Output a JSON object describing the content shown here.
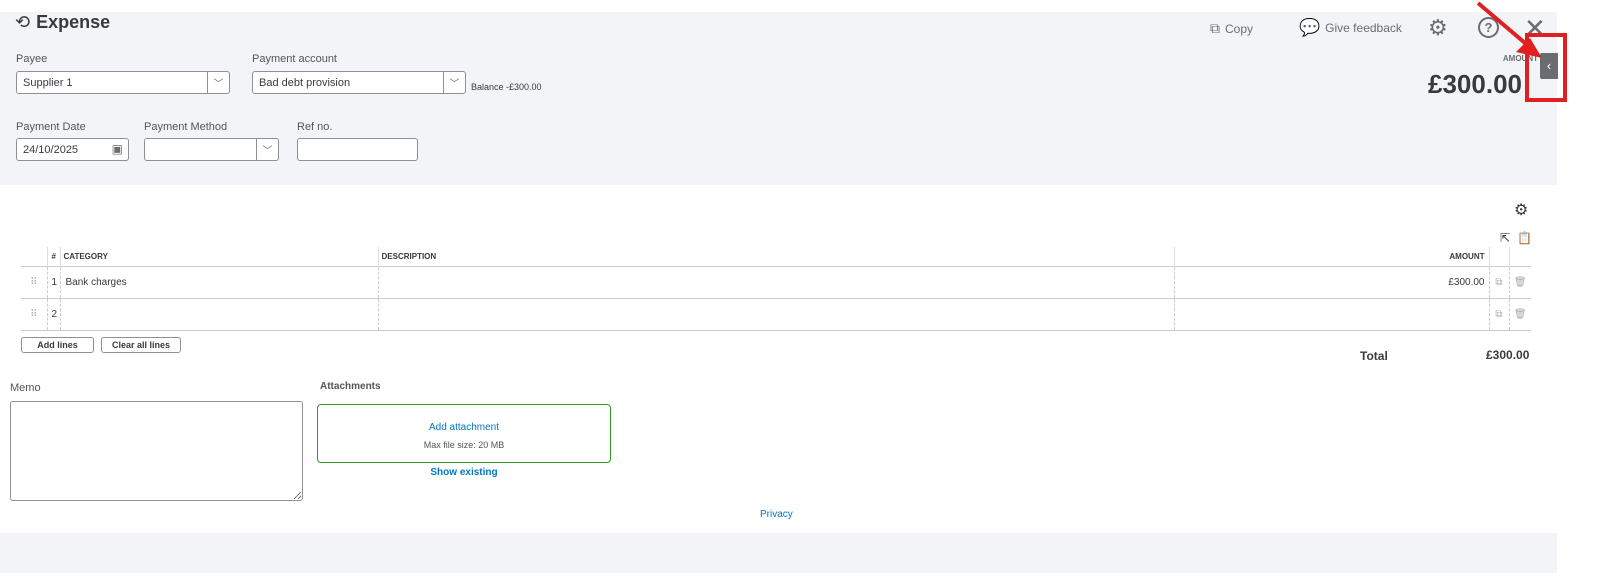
{
  "header": {
    "title": "Expense",
    "copy": "Copy",
    "feedback": "Give feedback",
    "amount_label": "AMOUNT",
    "amount": "£300.00"
  },
  "form": {
    "payee_label": "Payee",
    "payee": "Supplier 1",
    "account_label": "Payment account",
    "account": "Bad debt provision",
    "balance": "Balance -£300.00",
    "date_label": "Payment Date",
    "date": "24/10/2025",
    "method_label": "Payment Method",
    "method": "",
    "ref_label": "Ref no.",
    "ref": ""
  },
  "table": {
    "headers": [
      "#",
      "CATEGORY",
      "DESCRIPTION",
      "AMOUNT"
    ],
    "rows": [
      {
        "num": "1",
        "category": "Bank charges",
        "description": "",
        "amount": "£300.00"
      },
      {
        "num": "2",
        "category": "",
        "description": "",
        "amount": ""
      }
    ]
  },
  "actions": {
    "add_lines": "Add lines",
    "clear_lines": "Clear all lines"
  },
  "total": {
    "label": "Total",
    "value": "£300.00"
  },
  "memo": {
    "label": "Memo",
    "value": ""
  },
  "attachments": {
    "label": "Attachments",
    "add": "Add attachment",
    "max": "Max file size: 20 MB",
    "show": "Show existing"
  },
  "footer": {
    "privacy": "Privacy"
  },
  "colors": {
    "annotation": "#e02020",
    "accent": "#0077c5",
    "drop_border": "#2ca01c"
  }
}
